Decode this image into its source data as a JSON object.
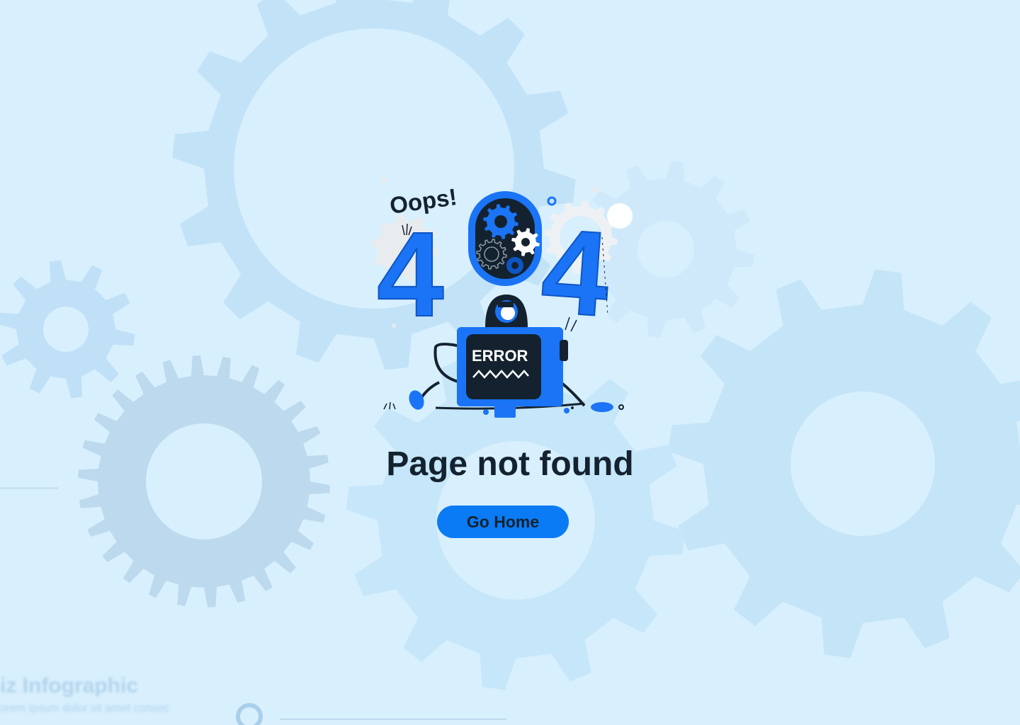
{
  "page": {
    "heading": "Page not found",
    "button_label": "Go  Home"
  },
  "illustration": {
    "exclamation": "Oops!",
    "digit_left": "4",
    "digit_right": "4",
    "screen_text": "ERROR"
  },
  "background": {
    "faded_title": "iz Infographic",
    "faded_subtitle": "orem ipsum dolor sit amet consec"
  },
  "colors": {
    "background": "#d8effd",
    "accent_blue": "#0a7bf5",
    "illustration_blue": "#1a74f5",
    "dark_navy": "#14222f"
  }
}
